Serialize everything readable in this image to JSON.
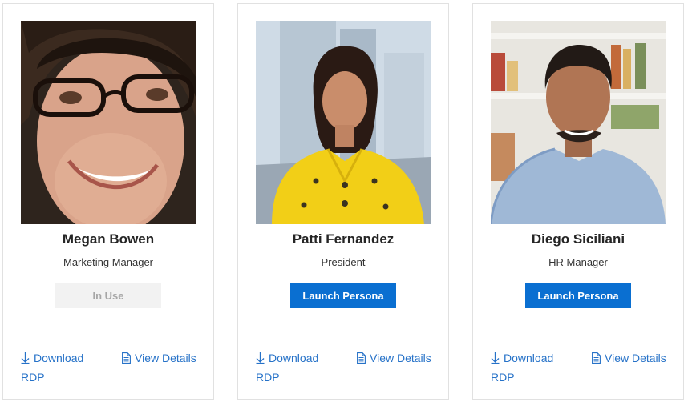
{
  "personas": [
    {
      "name": "Megan Bowen",
      "role": "Marketing Manager",
      "action_label": "In Use",
      "action_state": "disabled",
      "download_label": "Download RDP",
      "details_label": "View Details"
    },
    {
      "name": "Patti Fernandez",
      "role": "President",
      "action_label": "Launch Persona",
      "action_state": "enabled",
      "download_label": "Download RDP",
      "details_label": "View Details"
    },
    {
      "name": "Diego Siciliani",
      "role": "HR Manager",
      "action_label": "Launch Persona",
      "action_state": "enabled",
      "download_label": "Download RDP",
      "details_label": "View Details"
    }
  ],
  "colors": {
    "accent": "#0a6fd1",
    "link": "#2672c8",
    "disabled_bg": "#f2f2f2",
    "disabled_text": "#a6a6a6"
  },
  "icons": {
    "download": "download-arrow-icon",
    "details": "document-icon"
  }
}
